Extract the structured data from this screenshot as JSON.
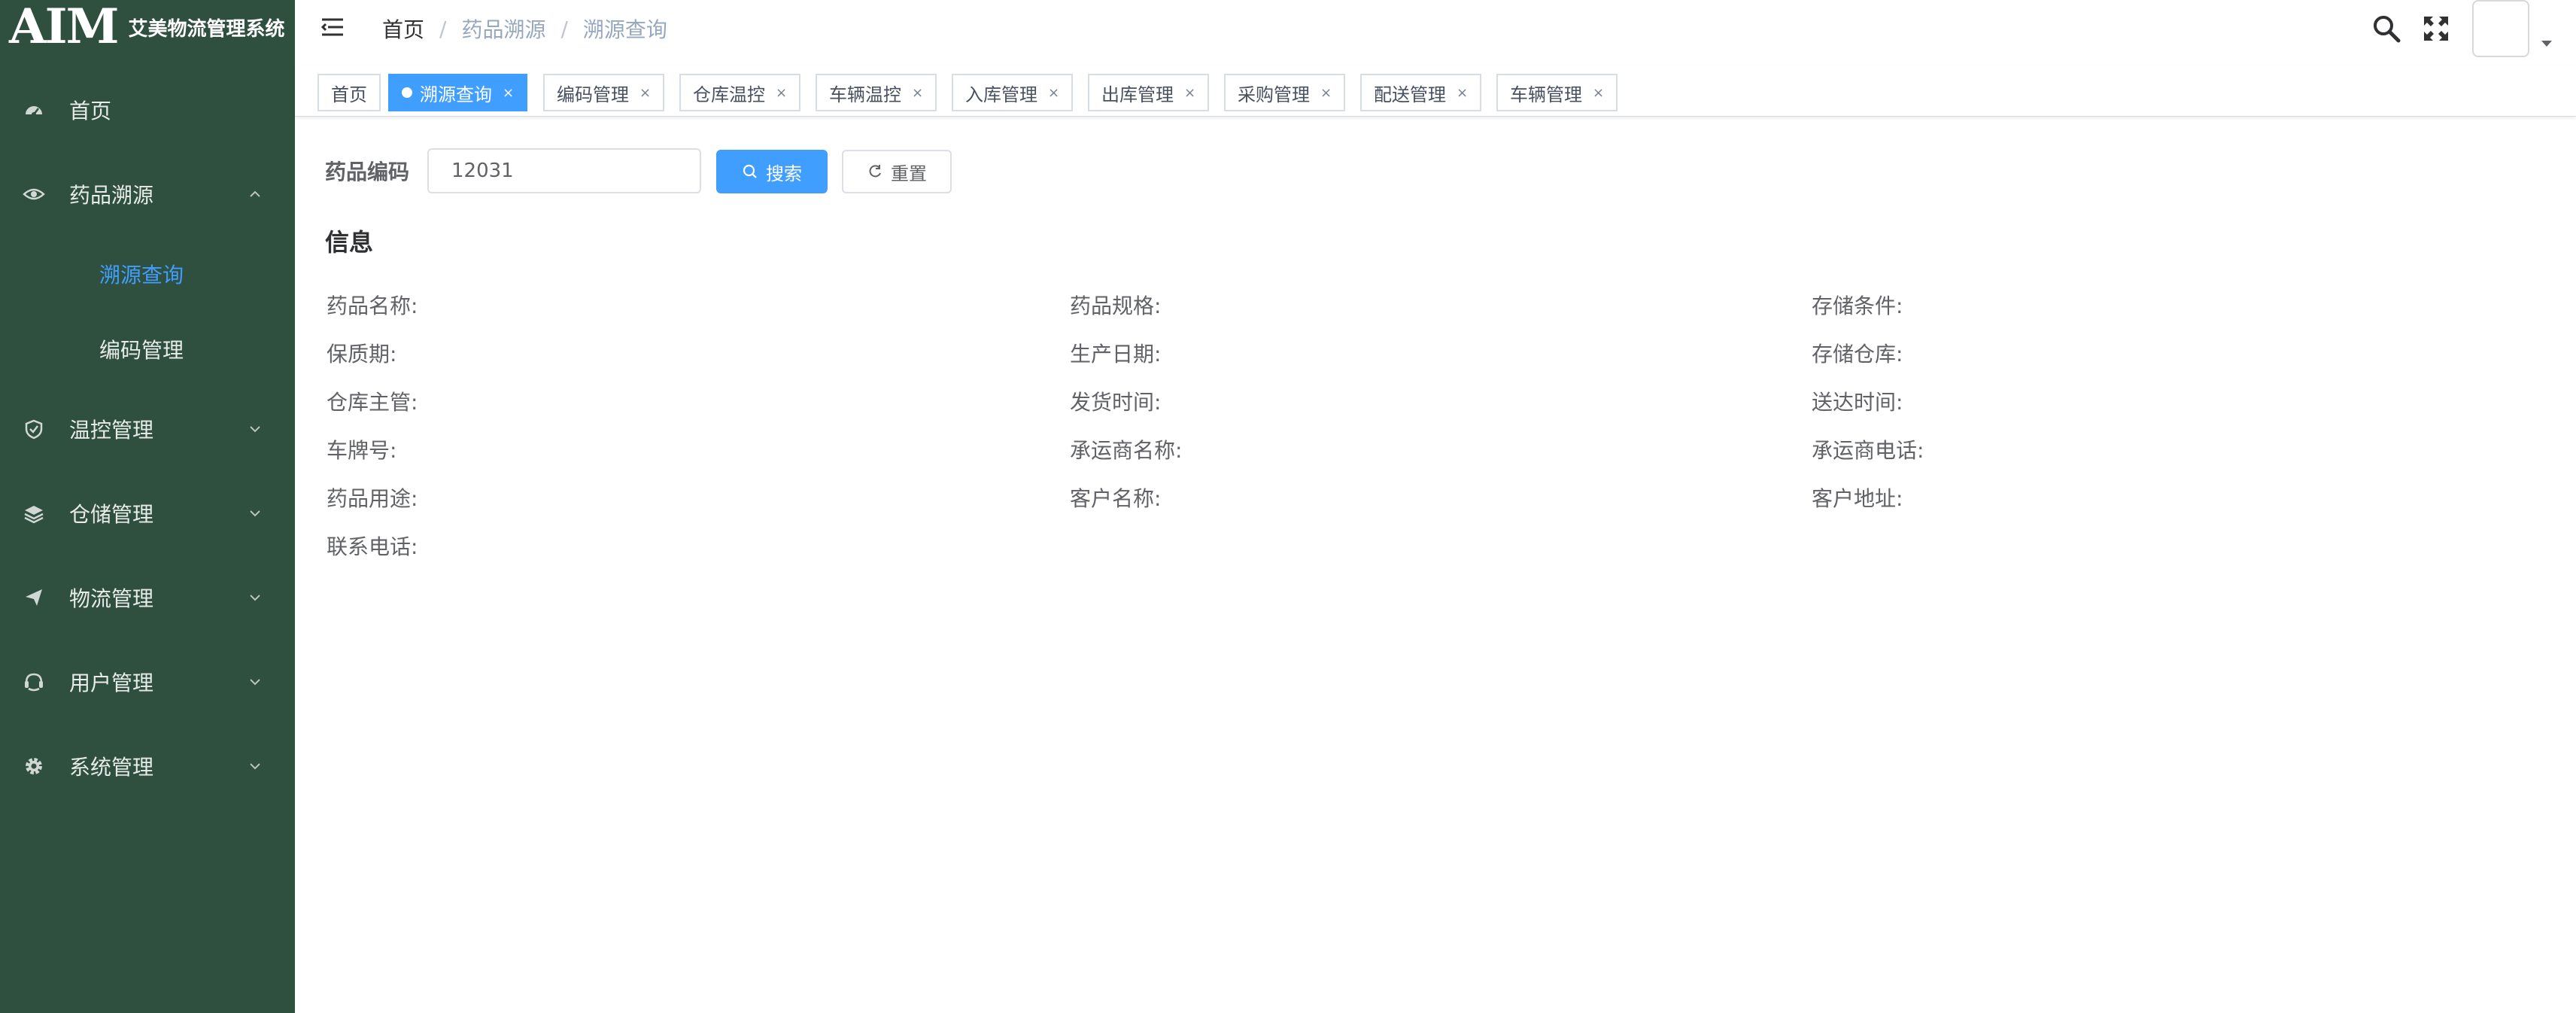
{
  "app": {
    "logo_text": "AIM",
    "title": "艾美物流管理系统"
  },
  "sidebar": {
    "items": [
      {
        "label": "首页",
        "icon": "dashboard-icon"
      },
      {
        "label": "药品溯源",
        "icon": "eye-icon",
        "expanded": true,
        "children": [
          {
            "label": "溯源查询",
            "active": true
          },
          {
            "label": "编码管理"
          }
        ]
      },
      {
        "label": "温控管理",
        "icon": "shield-icon"
      },
      {
        "label": "仓储管理",
        "icon": "layers-icon"
      },
      {
        "label": "物流管理",
        "icon": "send-icon"
      },
      {
        "label": "用户管理",
        "icon": "user-icon"
      },
      {
        "label": "系统管理",
        "icon": "gear-icon"
      }
    ]
  },
  "breadcrumb": [
    "首页",
    "药品溯源",
    "溯源查询"
  ],
  "tags": [
    {
      "label": "首页",
      "closable": false
    },
    {
      "label": "溯源查询",
      "active": true
    },
    {
      "label": "编码管理"
    },
    {
      "label": "仓库温控"
    },
    {
      "label": "车辆温控"
    },
    {
      "label": "入库管理"
    },
    {
      "label": "出库管理"
    },
    {
      "label": "采购管理"
    },
    {
      "label": "配送管理"
    },
    {
      "label": "车辆管理"
    }
  ],
  "tag_close_glyph": "×",
  "search": {
    "label": "药品编码",
    "value": "12031",
    "search_button": "搜索",
    "reset_button": "重置"
  },
  "info": {
    "title": "信息",
    "fields": [
      [
        "药品名称:",
        "药品规格:",
        "存储条件:"
      ],
      [
        "保质期:",
        "生产日期:",
        "存储仓库:"
      ],
      [
        "仓库主管:",
        "发货时间:",
        "送达时间:"
      ],
      [
        "车牌号:",
        "承运商名称:",
        "承运商电话:"
      ],
      [
        "药品用途:",
        "客户名称:",
        "客户地址:"
      ],
      [
        "联系电话:"
      ]
    ]
  },
  "colors": {
    "sidebar_bg": "#2f4f3f",
    "accent": "#409eff",
    "active_submenu": "#409eff"
  }
}
